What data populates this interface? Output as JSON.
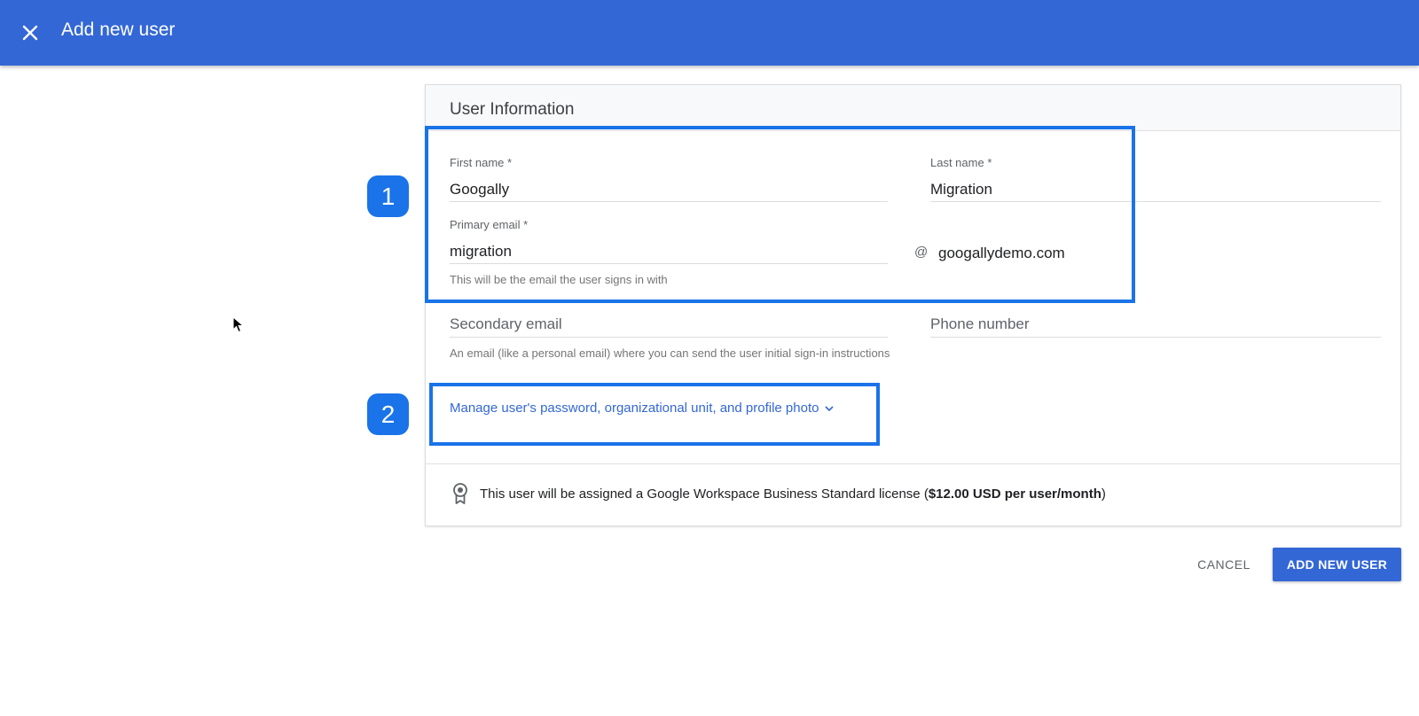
{
  "appbar": {
    "title": "Add new user",
    "close_icon": "close-icon",
    "color": "#3367d6"
  },
  "section": {
    "title": "User Information"
  },
  "form": {
    "first_name": {
      "label": "First name *",
      "value": "Googally"
    },
    "last_name": {
      "label": "Last name *",
      "value": "Migration"
    },
    "primary_email": {
      "label": "Primary email *",
      "value": "migration",
      "at": "@",
      "domain": "googallydemo.com",
      "helper": "This will be the email the user signs in with"
    },
    "secondary_email": {
      "placeholder": "Secondary email",
      "helper": "An email (like a personal email) where you can send the user initial sign-in instructions"
    },
    "phone": {
      "placeholder": "Phone number"
    },
    "manage_link": "Manage user's password, organizational unit, and profile photo"
  },
  "license": {
    "icon": "license-badge-icon",
    "text_before": "This user will be assigned a Google Workspace Business Standard license (",
    "price": "$12.00 USD per user/month",
    "text_after": ")"
  },
  "actions": {
    "cancel": "CANCEL",
    "add": "ADD NEW USER"
  },
  "annotations": {
    "badge_1": "1",
    "badge_2": "2",
    "highlight_color": "#1a73e8"
  }
}
